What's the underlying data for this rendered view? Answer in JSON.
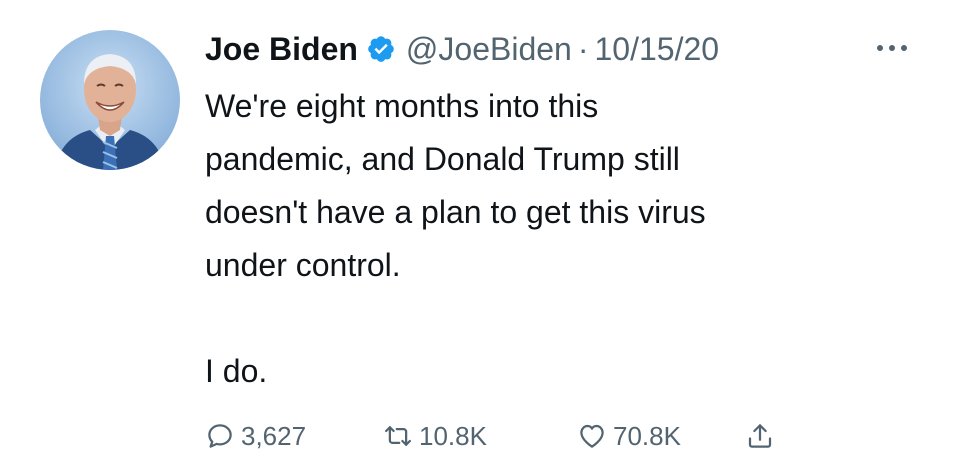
{
  "author": {
    "display_name": "Joe Biden",
    "handle": "@JoeBiden",
    "separator": "·",
    "date": "10/15/20",
    "verified": true,
    "avatar_icon": "profile-photo"
  },
  "tweet": {
    "lines": [
      "We're eight months into this",
      "pandemic, and Donald Trump still",
      "doesn't have a plan to get this virus",
      "under control.",
      "I do."
    ]
  },
  "actions": {
    "reply": {
      "icon": "reply-icon",
      "count": "3,627"
    },
    "retweet": {
      "icon": "retweet-icon",
      "count": "10.8K"
    },
    "like": {
      "icon": "heart-icon",
      "count": "70.8K"
    },
    "share": {
      "icon": "share-icon"
    }
  },
  "colors": {
    "text": "#0f1419",
    "secondary": "#536471",
    "verified": "#1d9bf0",
    "background": "#ffffff"
  }
}
